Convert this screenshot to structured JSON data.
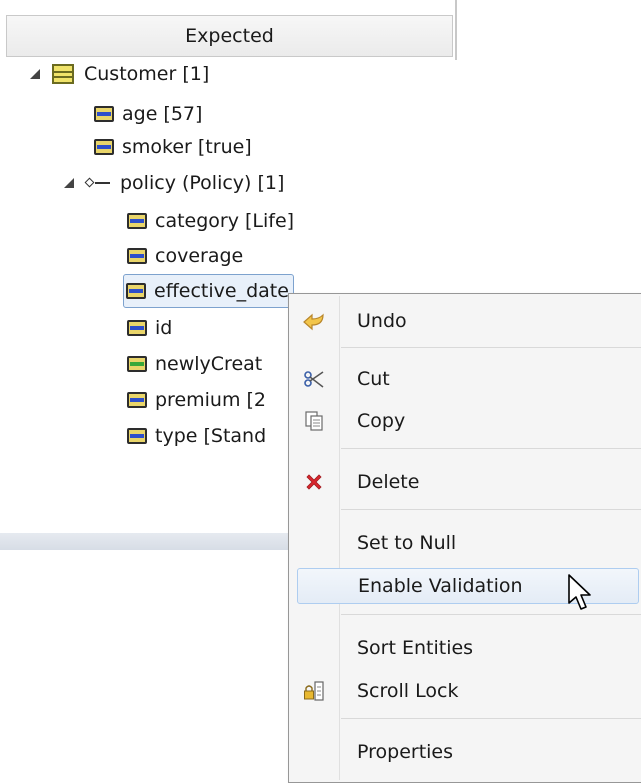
{
  "panel": {
    "header": "Expected"
  },
  "tree": {
    "root": "Customer [1]",
    "age": "age [57]",
    "smoker": "smoker [true]",
    "policy": "policy (Policy) [1]",
    "category": "category [Life]",
    "coverage": "coverage",
    "effective_date": "effective_date",
    "id": "id",
    "newlyCreated": "newlyCreat",
    "premium": "premium [2",
    "type": "type [Stand"
  },
  "menu": {
    "undo": "Undo",
    "cut": "Cut",
    "copy": "Copy",
    "delete": "Delete",
    "set_null": "Set to Null",
    "enable_validation": "Enable Validation",
    "sort": "Sort Entities",
    "scroll_lock": "Scroll Lock",
    "properties": "Properties"
  },
  "icons": {
    "undo": "undo-arrow-icon",
    "cut": "scissors-icon",
    "copy": "copy-icon",
    "delete": "delete-x-icon",
    "scroll_lock": "scroll-lock-icon"
  },
  "colors": {
    "selection_border": "#7da2ce",
    "hover_bg": "#e4ecf6",
    "delete_red": "#d9272e",
    "field_yellow": "#e9d56a",
    "field_blue": "#2d4ecb"
  }
}
